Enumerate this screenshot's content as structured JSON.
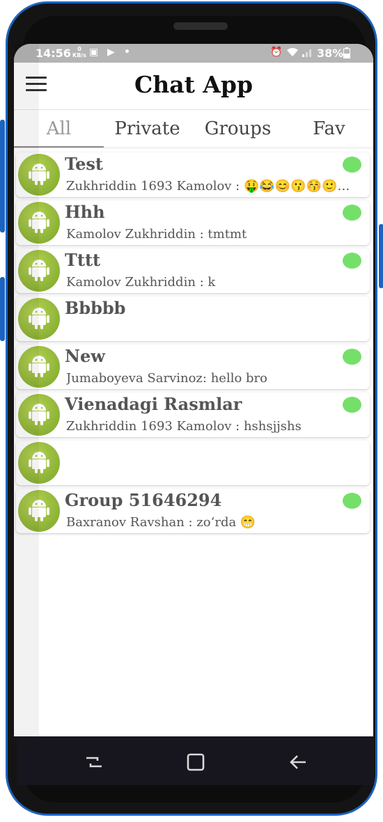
{
  "status_bar": {
    "time": "14:56",
    "net_speed_value": "0",
    "net_speed_unit": "KB/s",
    "battery": "38%"
  },
  "app_bar": {
    "title": "Chat App",
    "menu_icon": "menu-icon"
  },
  "tabs": [
    {
      "label": "All",
      "active": true
    },
    {
      "label": "Private",
      "active": false
    },
    {
      "label": "Groups",
      "active": false
    },
    {
      "label": "Fav",
      "active": false
    }
  ],
  "chats": [
    {
      "name": "Test",
      "last_message": "Zukhriddin 1693 Kamolov : 🤑😂😊😗😚🙂…",
      "online": true
    },
    {
      "name": "Hhh",
      "last_message": "Kamolov  Zukhriddin :  tmtmt",
      "online": true
    },
    {
      "name": "Tttt",
      "last_message": "Kamolov  Zukhriddin : k",
      "online": true
    },
    {
      "name": "Bbbbb",
      "last_message": "",
      "online": false
    },
    {
      "name": "New",
      "last_message": "Jumaboyeva Sarvinoz: hello bro",
      "online": true
    },
    {
      "name": "Vienadagi Rasmlar",
      "last_message": "Zukhriddin 1693 Kamolov : hshsjjshs",
      "online": true
    },
    {
      "name": "",
      "last_message": "",
      "online": false
    },
    {
      "name": "Group 51646294",
      "last_message": "Baxranov Ravshan : zo‘rda 😁",
      "online": true
    }
  ],
  "colors": {
    "online_indicator": "#74e06a",
    "avatar": "#9cc13e",
    "phone_frame_accent": "#1c64c0",
    "status_bar": "#b5b5b5",
    "nav_bar": "#17161f"
  }
}
